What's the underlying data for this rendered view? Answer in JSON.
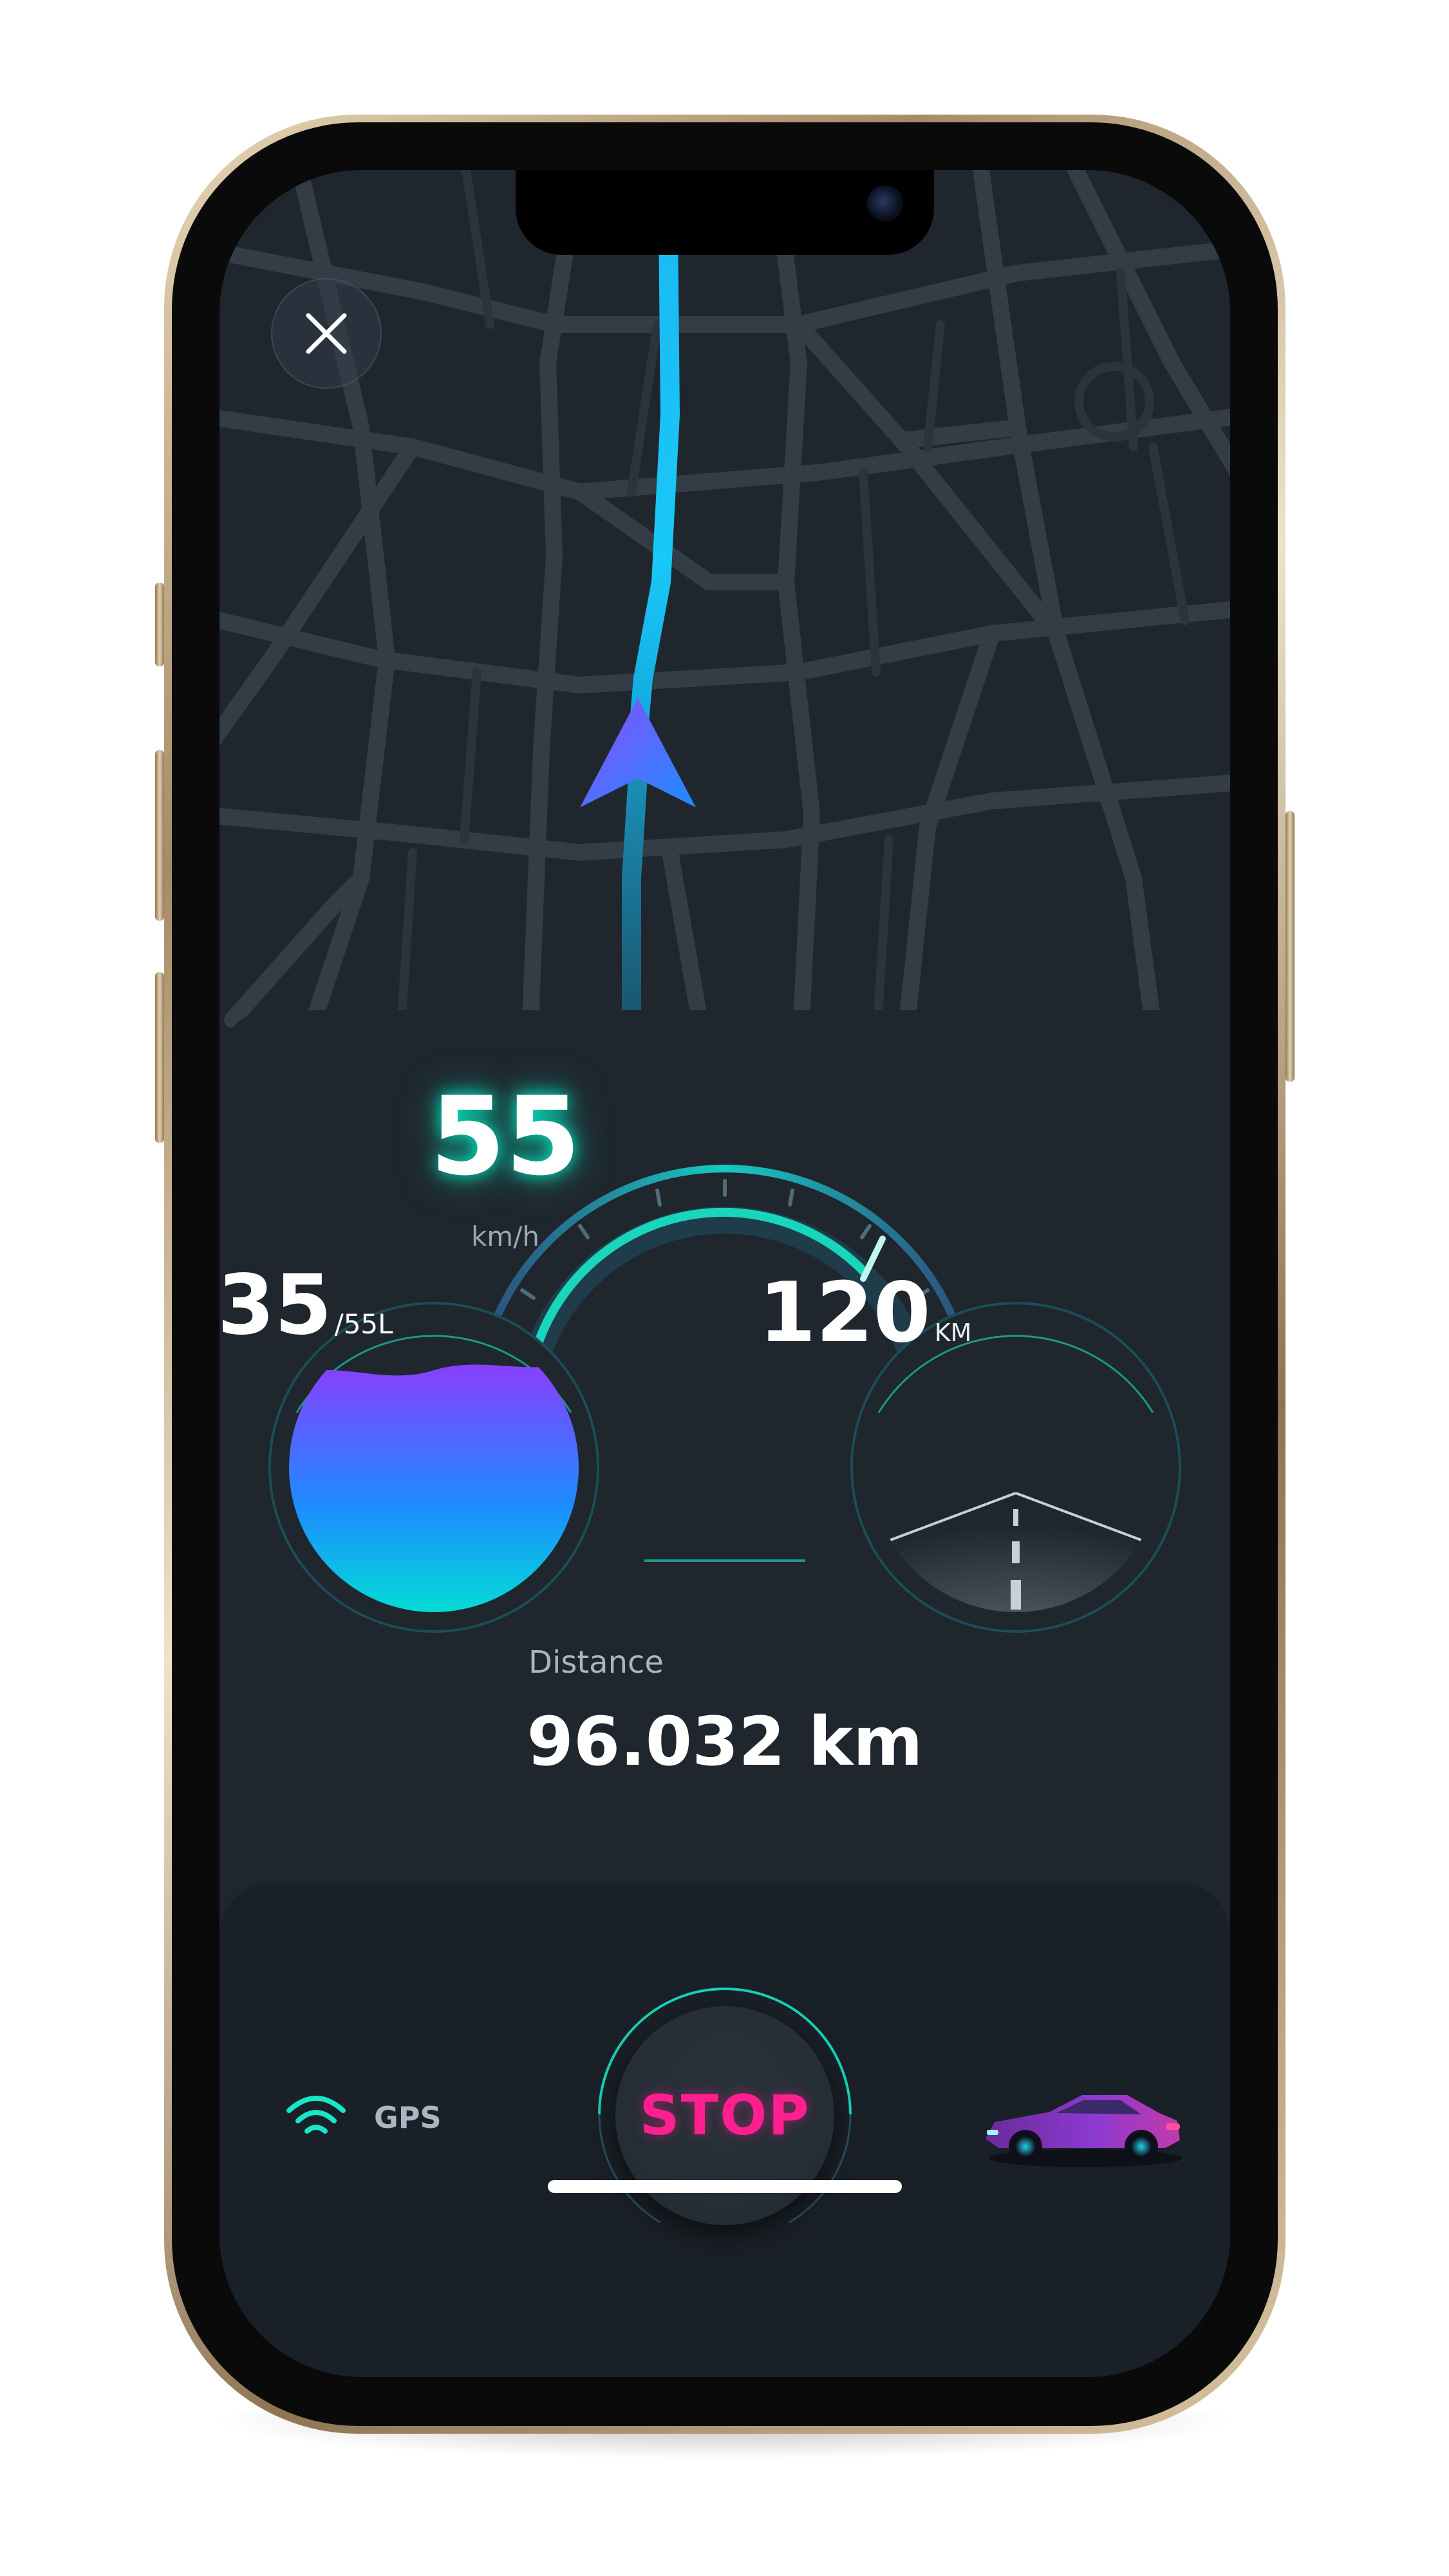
{
  "map": {
    "close_icon": "close-icon",
    "navigation_arrow_icon": "navigation-arrow-icon"
  },
  "speedometer": {
    "value": "55",
    "unit": "km/h",
    "level_fraction": 0.55,
    "accent_color": "#17e6c8"
  },
  "fuel": {
    "value": "35",
    "capacity": "/55L",
    "level_fraction": 0.64,
    "gradient_top": "#8b3dff",
    "gradient_bottom": "#00e6d0"
  },
  "range": {
    "value": "120",
    "unit": "KM",
    "road_icon": "road-icon"
  },
  "trip": {
    "distance_label": "Distance",
    "distance_value": "96.032 km"
  },
  "controls": {
    "stop_label": "STOP",
    "stop_color": "#ff1f8e"
  },
  "status": {
    "gps_label": "GPS",
    "gps_icon": "wifi-signal-icon",
    "car_icon": "sports-car-icon"
  }
}
